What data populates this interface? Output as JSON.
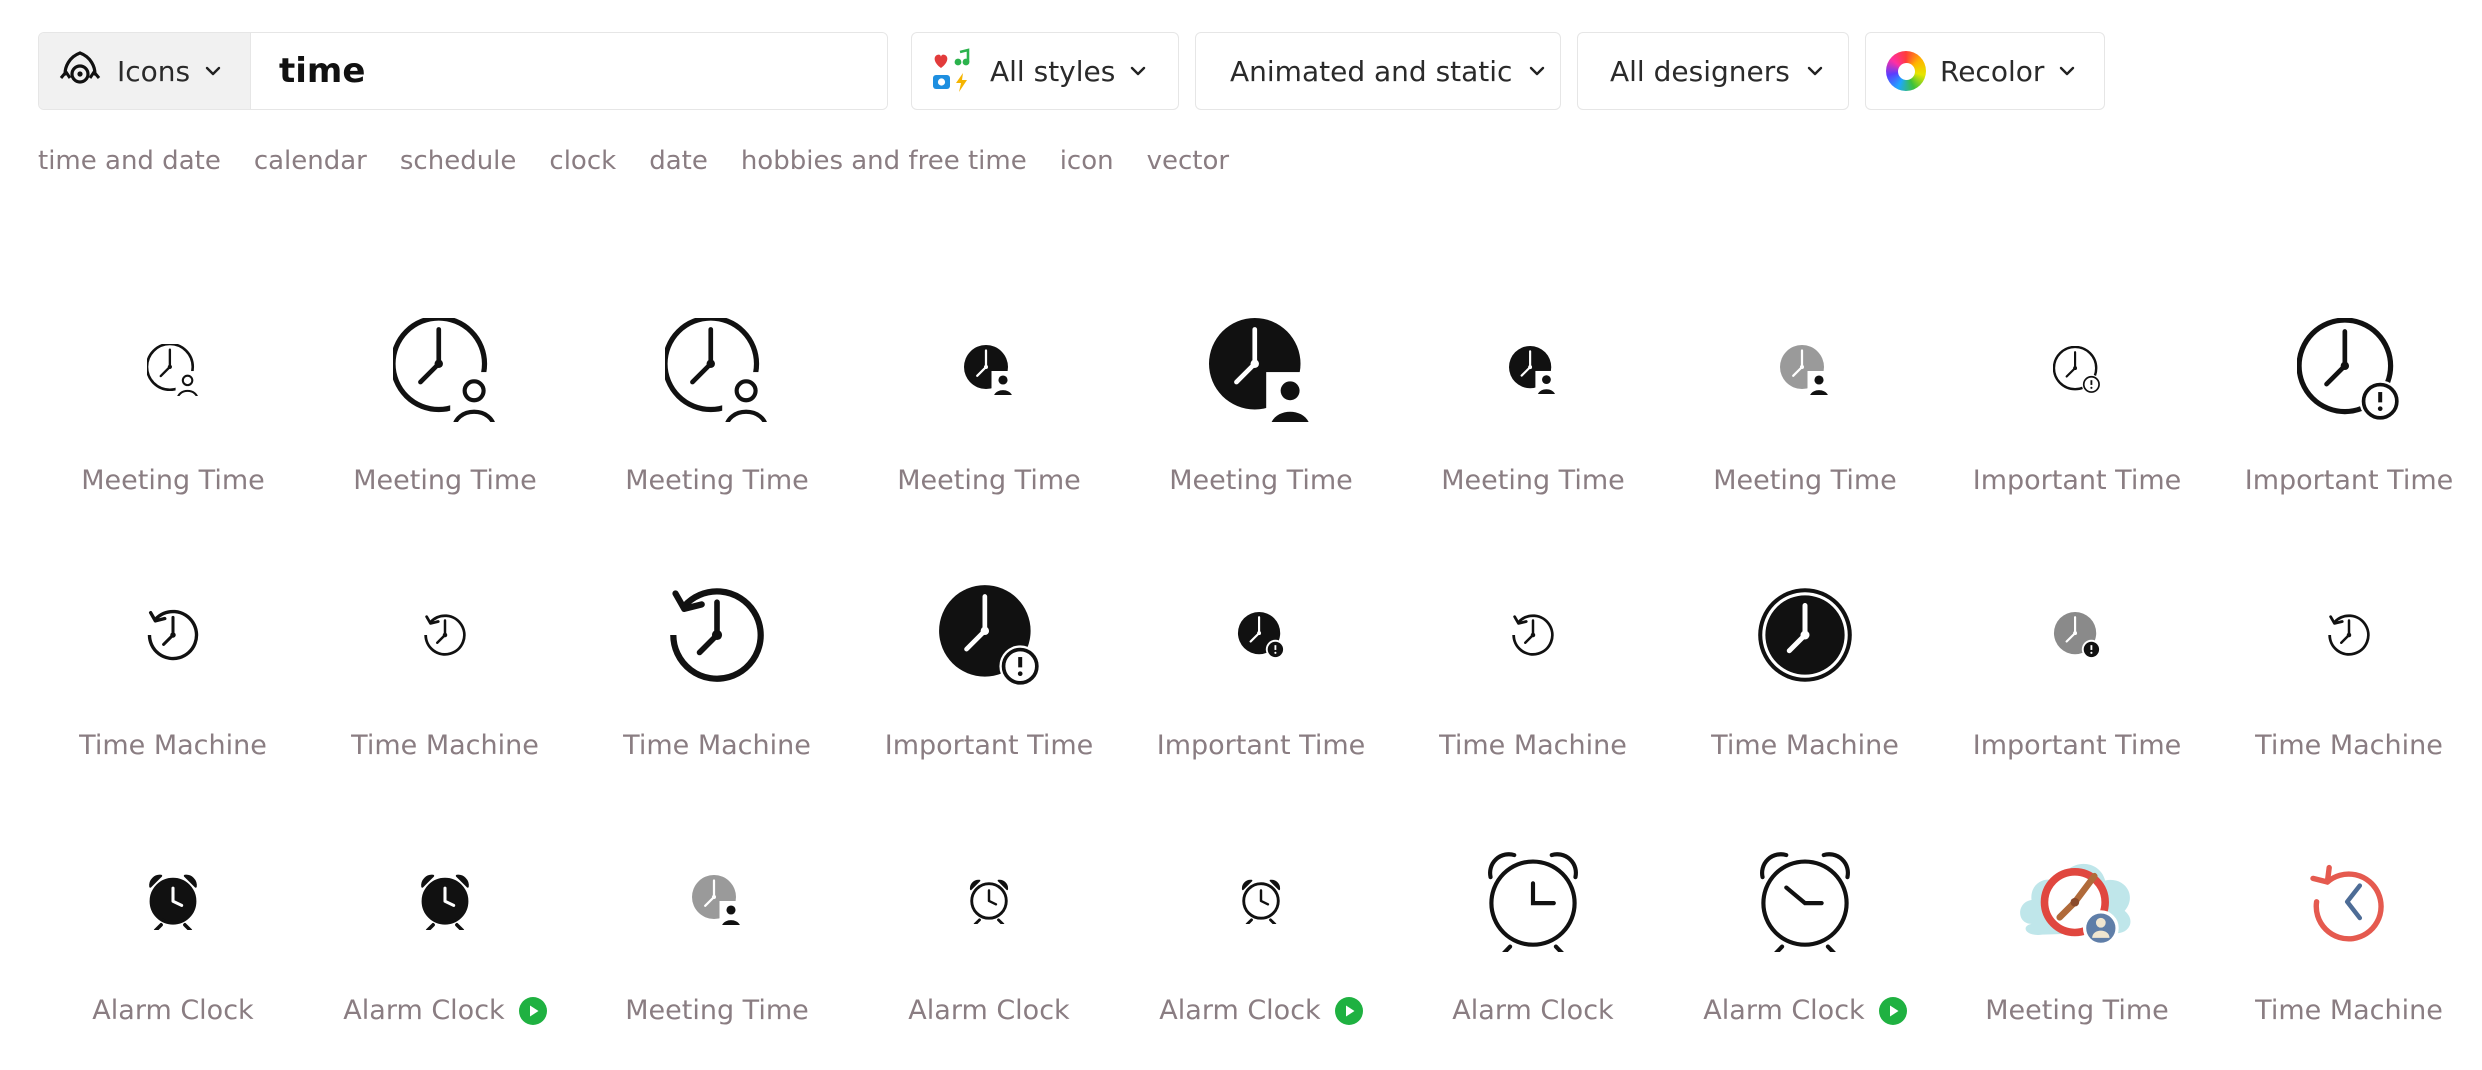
{
  "search": {
    "category_label": "Icons",
    "query": "time"
  },
  "filters": {
    "styles_label": "All styles",
    "animation_label": "Animated and static",
    "designers_label": "All designers",
    "recolor_label": "Recolor"
  },
  "tags": [
    "time and date",
    "calendar",
    "schedule",
    "clock",
    "date",
    "hobbies and free time",
    "icon",
    "vector"
  ],
  "icons": [
    {
      "title": "Meeting Time",
      "icon": "meeting-time-icon",
      "animated": false
    },
    {
      "title": "Meeting Time",
      "icon": "meeting-time-icon",
      "animated": false
    },
    {
      "title": "Meeting Time",
      "icon": "meeting-time-icon",
      "animated": false
    },
    {
      "title": "Meeting Time",
      "icon": "meeting-time-icon",
      "animated": false
    },
    {
      "title": "Meeting Time",
      "icon": "meeting-time-icon",
      "animated": false
    },
    {
      "title": "Meeting Time",
      "icon": "meeting-time-icon",
      "animated": false
    },
    {
      "title": "Meeting Time",
      "icon": "meeting-time-icon",
      "animated": false
    },
    {
      "title": "Important Time",
      "icon": "important-time-icon",
      "animated": false
    },
    {
      "title": "Important Time",
      "icon": "important-time-icon",
      "animated": false
    },
    {
      "title": "Time Machine",
      "icon": "time-machine-icon",
      "animated": false
    },
    {
      "title": "Time Machine",
      "icon": "time-machine-icon",
      "animated": false
    },
    {
      "title": "Time Machine",
      "icon": "time-machine-icon",
      "animated": false
    },
    {
      "title": "Important Time",
      "icon": "important-time-icon",
      "animated": false
    },
    {
      "title": "Important Time",
      "icon": "important-time-icon",
      "animated": false
    },
    {
      "title": "Time Machine",
      "icon": "time-machine-icon",
      "animated": false
    },
    {
      "title": "Time Machine",
      "icon": "time-machine-icon",
      "animated": false
    },
    {
      "title": "Important Time",
      "icon": "important-time-icon",
      "animated": false
    },
    {
      "title": "Time Machine",
      "icon": "time-machine-icon",
      "animated": false
    },
    {
      "title": "Alarm Clock",
      "icon": "alarm-clock-icon",
      "animated": false
    },
    {
      "title": "Alarm Clock",
      "icon": "alarm-clock-icon",
      "animated": true
    },
    {
      "title": "Meeting Time",
      "icon": "meeting-time-icon",
      "animated": false
    },
    {
      "title": "Alarm Clock",
      "icon": "alarm-clock-icon",
      "animated": false
    },
    {
      "title": "Alarm Clock",
      "icon": "alarm-clock-icon",
      "animated": true
    },
    {
      "title": "Alarm Clock",
      "icon": "alarm-clock-icon",
      "animated": false
    },
    {
      "title": "Alarm Clock",
      "icon": "alarm-clock-icon",
      "animated": true
    },
    {
      "title": "Meeting Time",
      "icon": "meeting-time-icon",
      "animated": false
    },
    {
      "title": "Time Machine",
      "icon": "time-machine-icon",
      "animated": false
    }
  ],
  "colors": {
    "tag_text": "#8a7d82",
    "play_badge": "#1fb141",
    "border": "#e6e6e6"
  }
}
